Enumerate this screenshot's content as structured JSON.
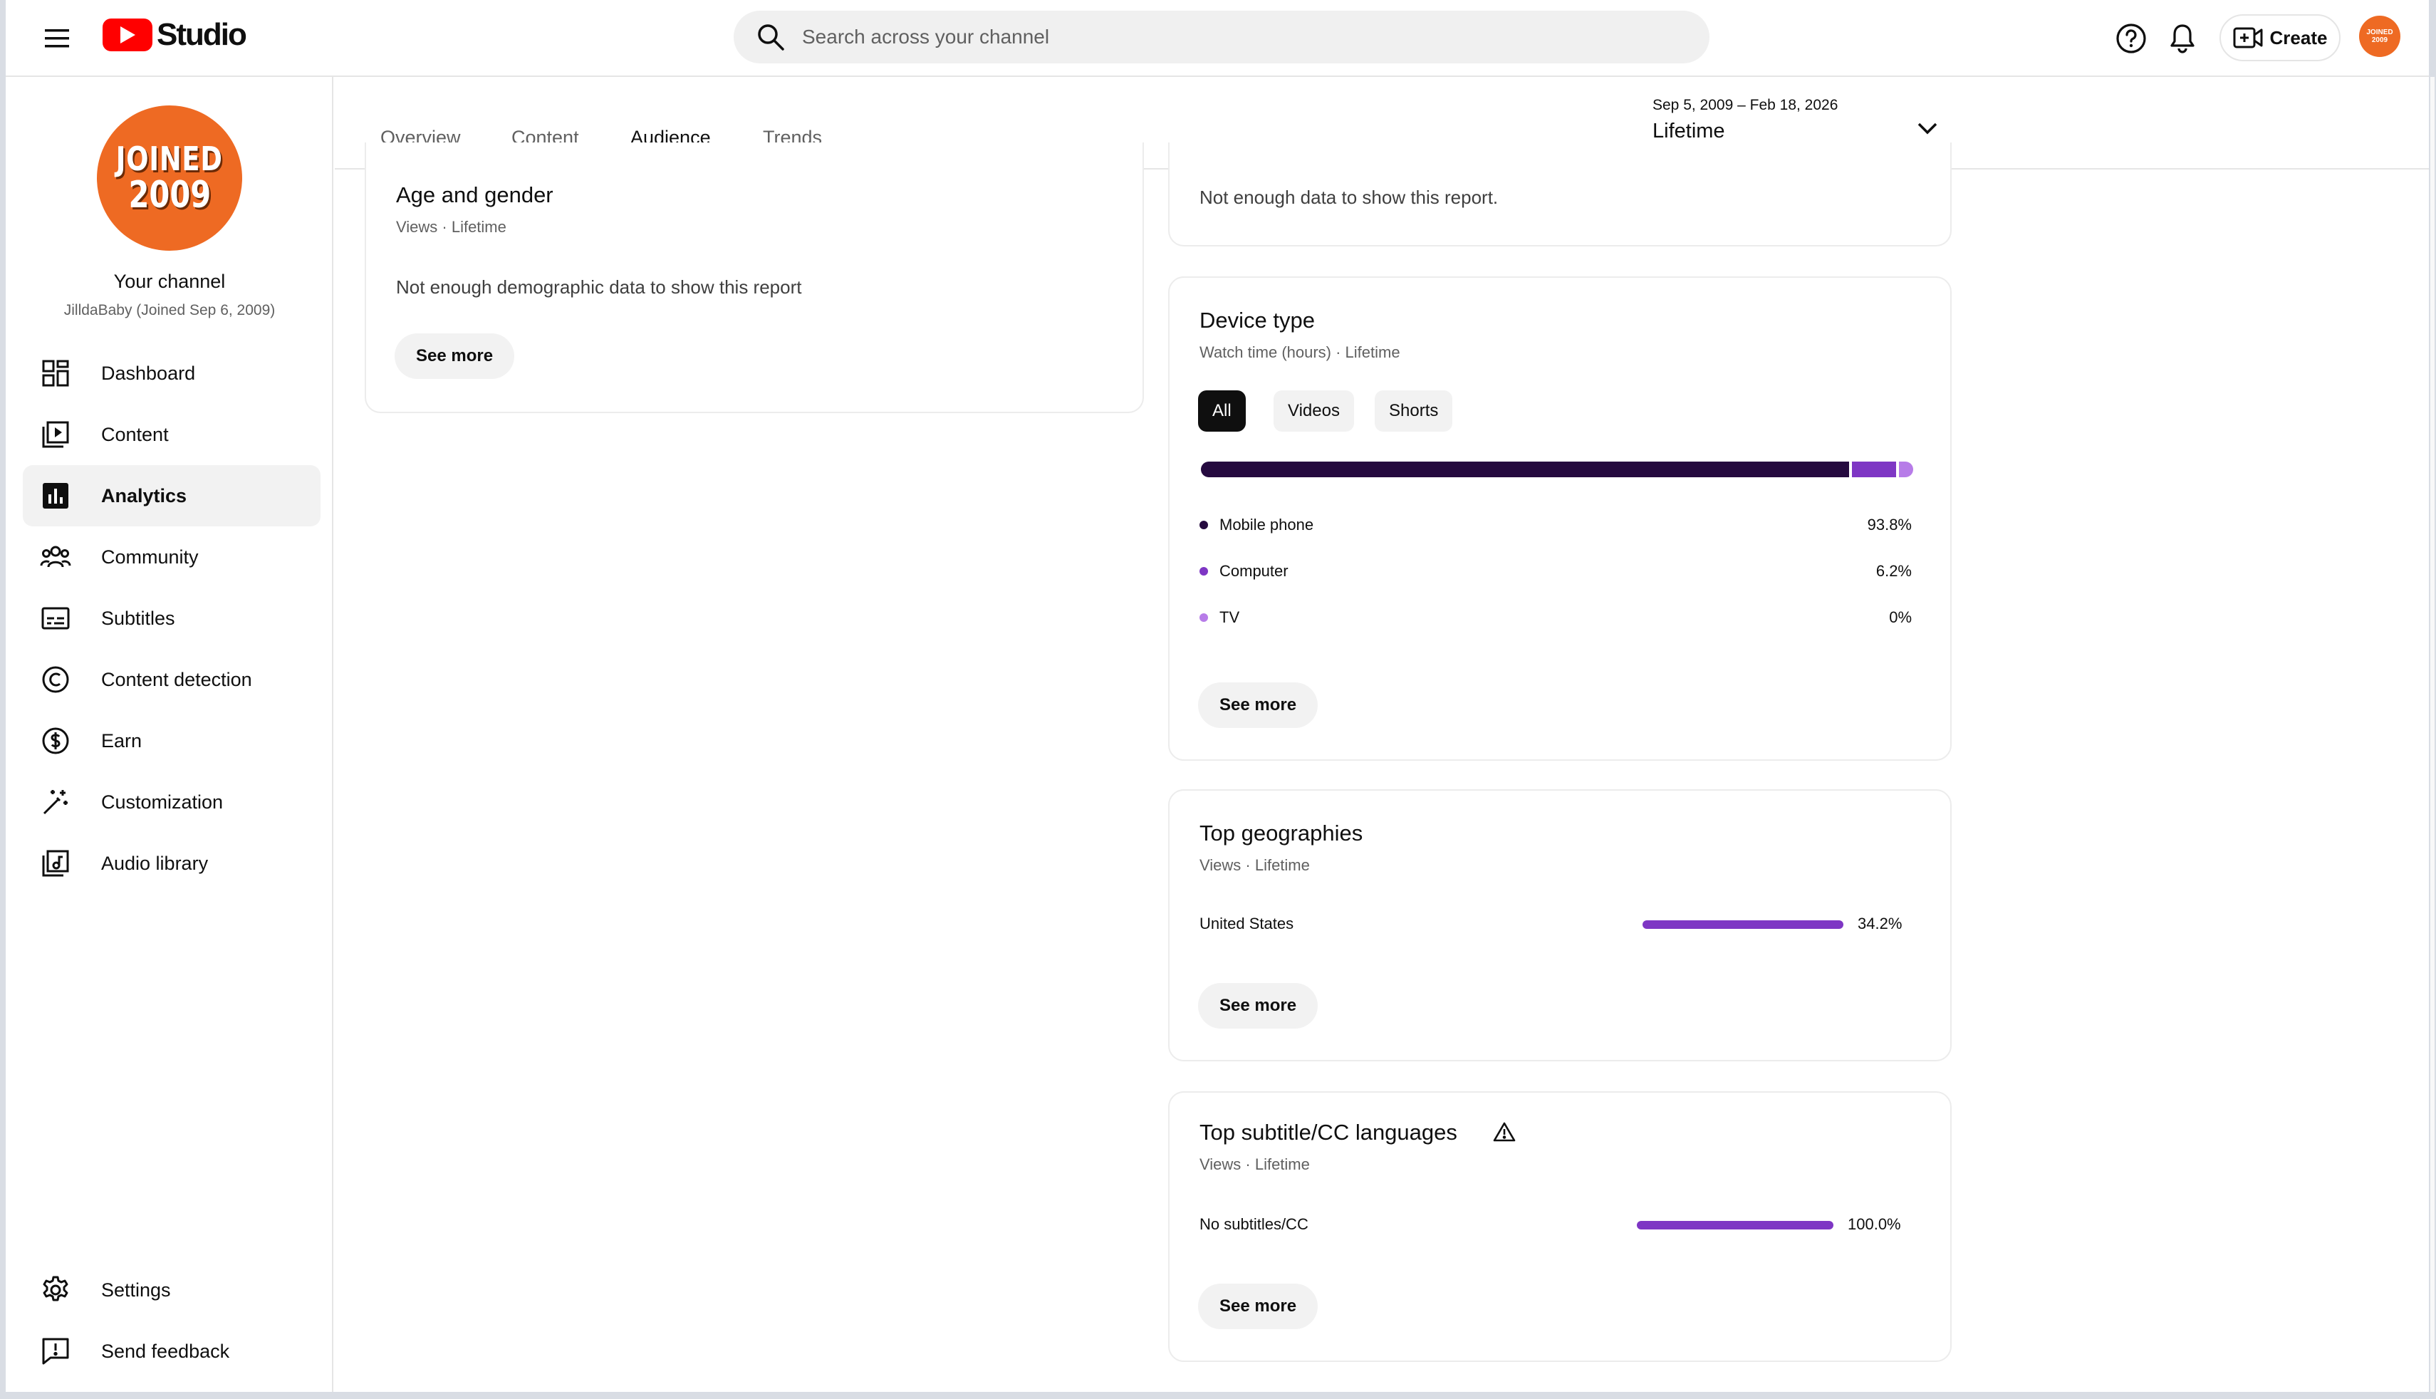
{
  "header": {
    "logo_text": "Studio",
    "search_placeholder": "Search across your channel",
    "create_label": "Create",
    "avatar_text": "JOINED 2009"
  },
  "sidebar": {
    "avatar_line1": "JOINED",
    "avatar_line2": "2009",
    "channel_name": "Your channel",
    "channel_sub": "JilldaBaby (Joined Sep 6, 2009)",
    "items": [
      {
        "label": "Dashboard",
        "icon": "dashboard-icon"
      },
      {
        "label": "Content",
        "icon": "content-icon"
      },
      {
        "label": "Analytics",
        "icon": "analytics-icon",
        "active": true
      },
      {
        "label": "Community",
        "icon": "community-icon"
      },
      {
        "label": "Subtitles",
        "icon": "subtitles-icon"
      },
      {
        "label": "Content detection",
        "icon": "copyright-icon"
      },
      {
        "label": "Earn",
        "icon": "dollar-icon"
      },
      {
        "label": "Customization",
        "icon": "magic-wand-icon"
      },
      {
        "label": "Audio library",
        "icon": "audio-library-icon"
      }
    ],
    "bottom_items": [
      {
        "label": "Settings",
        "icon": "gear-icon"
      },
      {
        "label": "Send feedback",
        "icon": "feedback-icon"
      }
    ]
  },
  "tabs": {
    "items": [
      "Overview",
      "Content",
      "Audience",
      "Trends"
    ],
    "active": "Audience",
    "date_range": "Sep 5, 2009 – Feb 18, 2026",
    "date_label": "Lifetime"
  },
  "cards": {
    "age_gender": {
      "title": "Age and gender",
      "subtitle": "Views · Lifetime",
      "message": "Not enough demographic data to show this report",
      "see_more": "See more"
    },
    "top_partial": {
      "message": "Not enough data to show this report."
    },
    "device_type": {
      "title": "Device type",
      "subtitle": "Watch time (hours) · Lifetime",
      "chips": [
        "All",
        "Videos",
        "Shorts"
      ],
      "active_chip": "All",
      "rows": [
        {
          "label": "Mobile phone",
          "value": "93.8%",
          "share": 0.938,
          "color": "#250a3f"
        },
        {
          "label": "Computer",
          "value": "6.2%",
          "share": 0.062,
          "color": "#7e36c4"
        },
        {
          "label": "TV",
          "value": "0%",
          "share": 0.0,
          "color": "#b77ce8"
        }
      ],
      "see_more": "See more"
    },
    "top_geographies": {
      "title": "Top geographies",
      "subtitle": "Views · Lifetime",
      "rows": [
        {
          "label": "United States",
          "value": "34.2%",
          "fraction": 1.0
        }
      ],
      "see_more": "See more"
    },
    "top_subtitles": {
      "title": "Top subtitle/CC languages",
      "subtitle": "Views · Lifetime",
      "rows": [
        {
          "label": "No subtitles/CC",
          "value": "100.0%",
          "fraction": 1.0
        }
      ],
      "see_more": "See more"
    }
  },
  "colors": {
    "brand_red": "#ff0000",
    "accent_purple": "#7e36c4",
    "dark_purple": "#250a3f",
    "light_purple": "#b77ce8",
    "avatar_orange": "#ee6a23"
  }
}
